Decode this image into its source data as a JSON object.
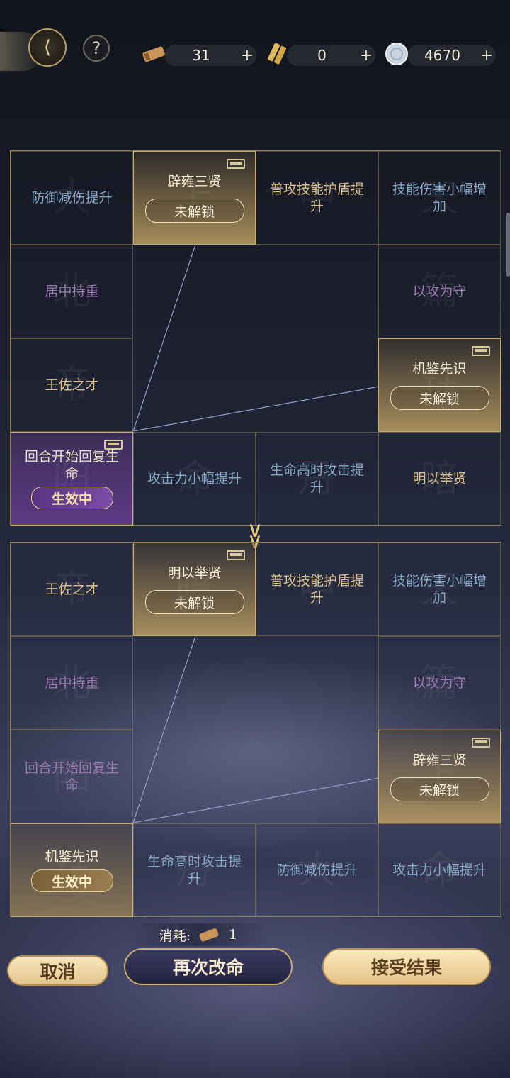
{
  "topbar": {
    "back_icon": "back-arrow-icon",
    "help_label": "?",
    "resources": [
      {
        "icon": "scroll-icon",
        "value": "31",
        "plus": "+"
      },
      {
        "icon": "bamboo-slips-icon",
        "value": "0",
        "plus": "+"
      },
      {
        "icon": "silver-coin-icon",
        "value": "4670",
        "plus": "+"
      }
    ]
  },
  "grid_current": {
    "cells": [
      {
        "label": "防御减伤提升",
        "style": "blue",
        "bg": "大"
      },
      {
        "label": "辟雍三贤",
        "style": "gold",
        "bg": "上",
        "pill": "未解锁"
      },
      {
        "label": "普攻技能护盾提升",
        "style": "tan",
        "bg": "中"
      },
      {
        "label": "技能伤害小幅增加",
        "style": "blue",
        "bg": "天"
      },
      {
        "label": "居中持重",
        "style": "purple",
        "bg": "北"
      },
      {
        "label": "以攻为守",
        "style": "purple",
        "bg": "篇"
      },
      {
        "label": "王佐之才",
        "style": "tan",
        "bg": "帝"
      },
      {
        "label": "机鉴先识",
        "style": "gold",
        "bg": "钰",
        "pill": "未解锁"
      },
      {
        "label": "回合开始回复生命",
        "style": "active",
        "bg": "阳",
        "pill": "生效中"
      },
      {
        "label": "攻击力小幅提升",
        "style": "blue",
        "bg": "命"
      },
      {
        "label": "生命高时攻击提升",
        "style": "blue",
        "bg": "丹"
      },
      {
        "label": "明以举贤",
        "style": "tan",
        "bg": "暗"
      }
    ]
  },
  "grid_result": {
    "cells": [
      {
        "label": "王佐之才",
        "style": "tan",
        "bg": "帝"
      },
      {
        "label": "明以举贤",
        "style": "gold",
        "bg": "暗",
        "pill": "未解锁"
      },
      {
        "label": "普攻技能护盾提升",
        "style": "tan",
        "bg": "中"
      },
      {
        "label": "技能伤害小幅增加",
        "style": "blue",
        "bg": "天"
      },
      {
        "label": "居中持重",
        "style": "purple",
        "bg": "北"
      },
      {
        "label": "以攻为守",
        "style": "purple",
        "bg": "篇"
      },
      {
        "label": "回合开始回复生命",
        "style": "purple",
        "bg": "阳"
      },
      {
        "label": "辟雍三贤",
        "style": "gold",
        "bg": "上",
        "pill": "未解锁"
      },
      {
        "label": "机鉴先识",
        "style": "gold2",
        "bg": "钰",
        "pill": "生效中"
      },
      {
        "label": "生命高时攻击提升",
        "style": "blue",
        "bg": "丹"
      },
      {
        "label": "防御减伤提升",
        "style": "blue",
        "bg": "大"
      },
      {
        "label": "攻击力小幅提升",
        "style": "blue",
        "bg": "命"
      }
    ]
  },
  "footer": {
    "cost_label": "消耗:",
    "cost_icon": "scroll-icon",
    "cost_value": "1",
    "cancel_label": "取消",
    "retry_label": "再次改命",
    "accept_label": "接受结果"
  },
  "colors": {
    "gold": "#c8ad72",
    "active_purple": "#64408c",
    "accept_bg": "#f3d9a4"
  }
}
